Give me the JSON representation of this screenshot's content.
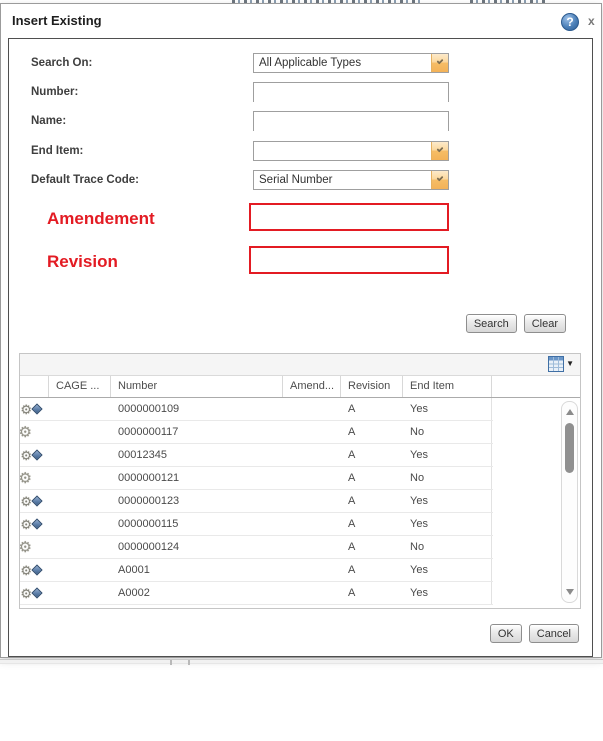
{
  "dialog": {
    "title": "Insert Existing",
    "help_glyph": "?",
    "close_glyph": "x"
  },
  "form": {
    "fields": [
      {
        "label": "Search On:",
        "type": "select",
        "value": "All Applicable Types"
      },
      {
        "label": "Number:",
        "type": "text",
        "value": "",
        "placeholder": ""
      },
      {
        "label": "Name:",
        "type": "text",
        "value": "",
        "placeholder": ""
      },
      {
        "label": "End Item:",
        "type": "select",
        "value": ""
      },
      {
        "label": "Default Trace Code:",
        "type": "select",
        "value": "Serial Number"
      }
    ],
    "highlighted_fields": [
      {
        "label": "Amendement",
        "value": ""
      },
      {
        "label": "Revision",
        "value": ""
      }
    ],
    "buttons": {
      "search": "Search",
      "clear": "Clear"
    }
  },
  "table": {
    "columns": [
      "",
      "CAGE ...",
      "Number",
      "Amend...",
      "Revision",
      "End Item",
      ""
    ],
    "rows": [
      {
        "icon": "end-item",
        "cage": "",
        "number": "0000000109",
        "amendment": "",
        "revision": "A",
        "end_item": "Yes"
      },
      {
        "icon": "item",
        "cage": "",
        "number": "0000000117",
        "amendment": "",
        "revision": "A",
        "end_item": "No"
      },
      {
        "icon": "end-item",
        "cage": "",
        "number": "00012345",
        "amendment": "",
        "revision": "A",
        "end_item": "Yes"
      },
      {
        "icon": "item",
        "cage": "",
        "number": "0000000121",
        "amendment": "",
        "revision": "A",
        "end_item": "No"
      },
      {
        "icon": "end-item",
        "cage": "",
        "number": "0000000123",
        "amendment": "",
        "revision": "A",
        "end_item": "Yes"
      },
      {
        "icon": "end-item",
        "cage": "",
        "number": "0000000115",
        "amendment": "",
        "revision": "A",
        "end_item": "Yes"
      },
      {
        "icon": "item",
        "cage": "",
        "number": "0000000124",
        "amendment": "",
        "revision": "A",
        "end_item": "No"
      },
      {
        "icon": "end-item",
        "cage": "",
        "number": "A0001",
        "amendment": "",
        "revision": "A",
        "end_item": "Yes"
      },
      {
        "icon": "end-item",
        "cage": "",
        "number": "A0002",
        "amendment": "",
        "revision": "A",
        "end_item": "Yes"
      }
    ],
    "gear_glyph": "⚙"
  },
  "footer": {
    "ok": "OK",
    "cancel": "Cancel"
  },
  "colors": {
    "alert_red": "#e31b23",
    "trigger_orange": "#f3b258",
    "help_blue": "#3a6ea5",
    "panel_border": "#4f4f4f"
  }
}
